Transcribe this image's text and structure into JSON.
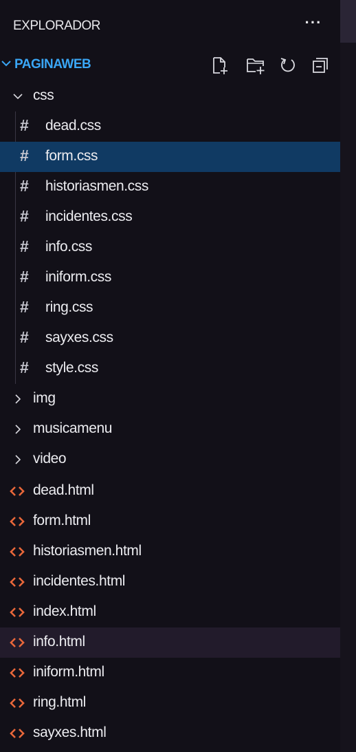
{
  "explorer": {
    "title": "EXPLORADOR",
    "more_label": "···",
    "project": {
      "name": "PAGINAWEB",
      "actions": [
        {
          "name": "new-file-icon"
        },
        {
          "name": "new-folder-icon"
        },
        {
          "name": "refresh-icon"
        },
        {
          "name": "collapse-all-icon"
        }
      ]
    },
    "tree": {
      "css_folder": "css",
      "css_files": [
        "dead.css",
        "form.css",
        "historiasmen.css",
        "incidentes.css",
        "info.css",
        "iniform.css",
        "ring.css",
        "sayxes.css",
        "style.css"
      ],
      "folders": [
        "img",
        "musicamenu",
        "video"
      ],
      "html_files": [
        "dead.html",
        "form.html",
        "historiasmen.html",
        "incidentes.html",
        "index.html",
        "info.html",
        "iniform.html",
        "ring.html",
        "sayxes.html"
      ]
    },
    "colors": {
      "background": "#121018",
      "selected": "#103a63",
      "hover": "#221b2b",
      "project_title": "#3aa6f5",
      "html_icon": "#e8673a"
    }
  }
}
